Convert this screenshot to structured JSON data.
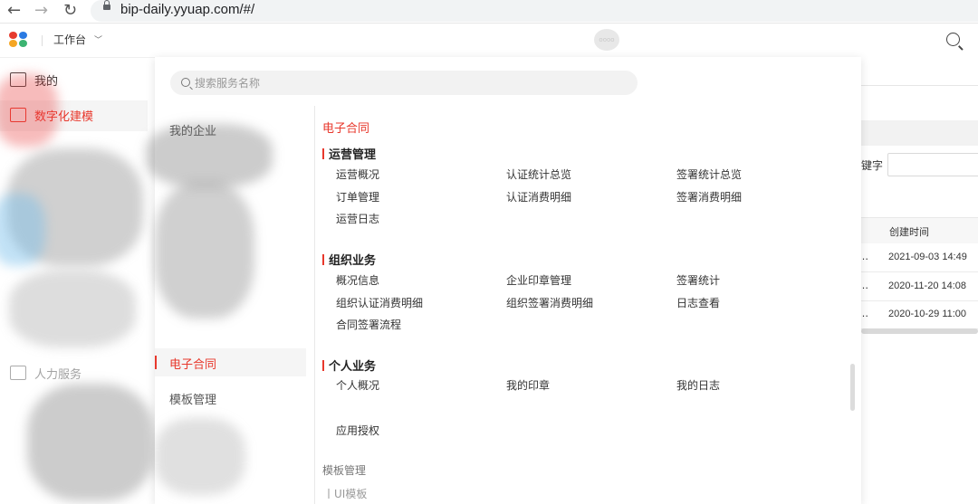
{
  "browser": {
    "url": "bip-daily.yyuap.com/#/"
  },
  "header": {
    "workbench_label": "工作台",
    "avatar_text": "oooo"
  },
  "left_nav": {
    "items": [
      {
        "label": "我的"
      },
      {
        "label": "数字化建模"
      },
      {
        "label": "人力服务"
      }
    ]
  },
  "panel": {
    "search_placeholder": "搜索服务名称",
    "categories": [
      {
        "label": "我的企业"
      },
      {
        "label": "电子合同"
      },
      {
        "label": "模板管理"
      }
    ],
    "content_title": "电子合同",
    "groups": [
      {
        "title": "运营管理",
        "items": [
          "运营概况",
          "认证统计总览",
          "签署统计总览",
          "订单管理",
          "认证消费明细",
          "签署消费明细",
          "运营日志"
        ]
      },
      {
        "title": "组织业务",
        "items": [
          "概况信息",
          "企业印章管理",
          "签署统计",
          "组织认证消费明细",
          "组织签署消费明细",
          "日志查看",
          "合同签署流程"
        ]
      },
      {
        "title": "个人业务",
        "items": [
          "个人概况",
          "我的印章",
          "我的日志"
        ]
      }
    ],
    "standalone_item": "应用授权",
    "sub_section": {
      "title": "模板管理",
      "item": "UI模板"
    }
  },
  "background_page": {
    "keyword_label": "键字",
    "column_header": "创建时间",
    "rows": [
      {
        "time": "2021-09-03 14:49"
      },
      {
        "time": "2020-11-20 14:08"
      },
      {
        "time": "2020-10-29 11:00"
      }
    ]
  },
  "colors": {
    "accent": "#e8382c",
    "panel_bg": "#ffffff",
    "nav_active_bg": "#f5f5f5"
  }
}
